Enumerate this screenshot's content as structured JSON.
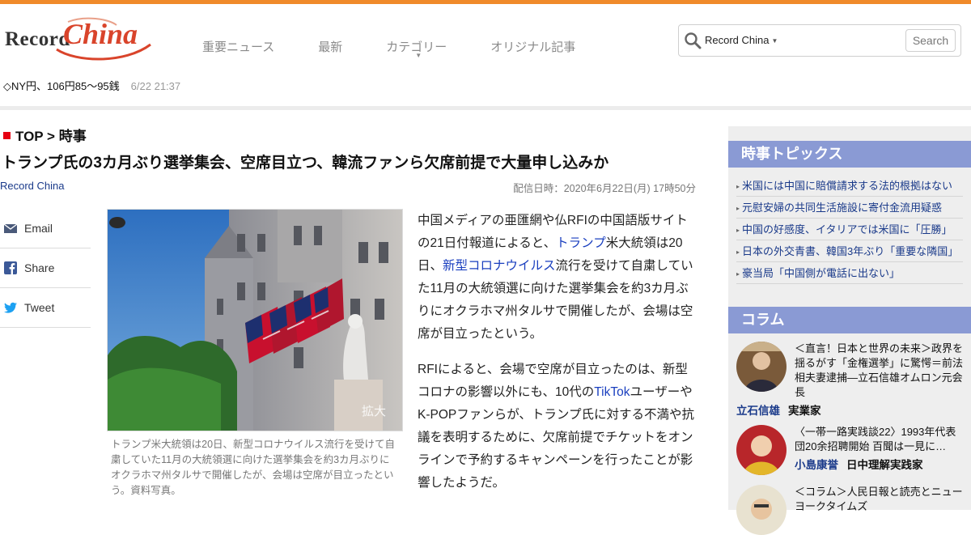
{
  "header": {
    "logo_text_1": "Record",
    "logo_text_2": "China",
    "nav": [
      "重要ニュース",
      "最新",
      "カテゴリー",
      "オリジナル記事"
    ],
    "search": {
      "scope": "Record China",
      "button": "Search"
    },
    "accent_color": "#f08a2a"
  },
  "ticker": {
    "text": "◇NY円、106円85～95銭",
    "time": "6/22 21:37"
  },
  "article": {
    "breadcrumb": "TOP > 時事",
    "headline": "トランプ氏の3カ月ぶり選挙集会、空席目立つ、韓流ファンら欠席前提で大量申し込みか",
    "source": "Record China",
    "pubdate": "配信日時：2020年6月22日(月) 17時50分",
    "zoom_label": "拡大",
    "caption": "トランプ米大統領は20日、新型コロナウイルス流行を受けて自粛していた11月の大統領選に向けた選挙集会を約3カ月ぶりにオクラホマ州タルサで開催したが、会場は空席が目立ったという。資料写真。",
    "p1": {
      "a": "中国メディアの亜匯網や仏RFIの中国語版サイトの21日付報道によると、",
      "link1": "トランプ",
      "b": "米大統領は20日、",
      "link2": "新型コロナウイルス",
      "c": "流行を受けて自粛していた11月の大統領選に向けた選挙集会を約3カ月ぶりにオクラホマ州タルサで開催したが、会場は空席が目立ったという。"
    },
    "p2": {
      "a": "RFIによると、会場で空席が目立ったのは、新型コロナの影響以外にも、10代の",
      "link1": "TikTok",
      "b": "ユーザーやK-POPファンらが、トランプ氏に対する不満や抗議を表明するために、欠席前提でチケットをオンラインで予約するキャンペーンを行ったことが影響したようだ。"
    }
  },
  "share": [
    {
      "label": "Email",
      "icon": "email-icon"
    },
    {
      "label": "Share",
      "icon": "facebook-icon"
    },
    {
      "label": "Tweet",
      "icon": "twitter-icon"
    }
  ],
  "sidebar": {
    "topics_title": "時事トピックス",
    "topics": [
      "米国には中国に賠償請求する法的根拠はない",
      "元慰安婦の共同生活施設に寄付金流用疑惑",
      "中国の好感度、イタリアでは米国に「圧勝」",
      "日本の外交青書、韓国3年ぶり「重要な隣国」",
      "豪当局「中国側が電話に出ない」"
    ],
    "column_title": "コラム",
    "columns": [
      {
        "text": "＜直言！日本と世界の未来＞政界を揺るがす「金権選挙」に驚愕＝前法相夫妻逮捕―立石信雄オムロン元会長",
        "author": "立石信雄",
        "role": "実業家"
      },
      {
        "text": "〈一帯一路実践談22〉1993年代表団20余招聘開始 百聞は一見に…",
        "author": "小島康誉",
        "role": "日中理解実践家"
      },
      {
        "text": "＜コラム＞人民日報と読売とニューヨークタイムズ",
        "author": "",
        "role": ""
      }
    ],
    "header_color": "#8a9ad4"
  }
}
